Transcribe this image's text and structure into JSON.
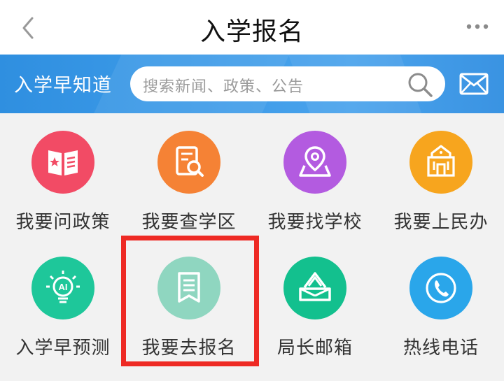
{
  "header": {
    "title": "入学报名"
  },
  "banner": {
    "label": "入学早知道",
    "search_placeholder": "搜索新闻、政策、公告"
  },
  "services": [
    {
      "label": "我要问政策",
      "icon": "policy-book-icon",
      "color": "#f24b65"
    },
    {
      "label": "我要查学区",
      "icon": "document-search-icon",
      "color": "#f58235"
    },
    {
      "label": "我要找学校",
      "icon": "map-location-icon",
      "color": "#b35be0"
    },
    {
      "label": "我要上民办",
      "icon": "school-building-icon",
      "color": "#f7a51e"
    },
    {
      "label": "入学早预测",
      "icon": "ai-bulb-icon",
      "color": "#1ec79a"
    },
    {
      "label": "我要去报名",
      "icon": "bookmark-page-icon",
      "color": "#8fd6c0"
    },
    {
      "label": "局长邮箱",
      "icon": "mailbox-icon",
      "color": "#13c08e"
    },
    {
      "label": "热线电话",
      "icon": "phone-icon",
      "color": "#2aa6ea"
    }
  ],
  "highlight": {
    "color": "#ee2a24"
  }
}
